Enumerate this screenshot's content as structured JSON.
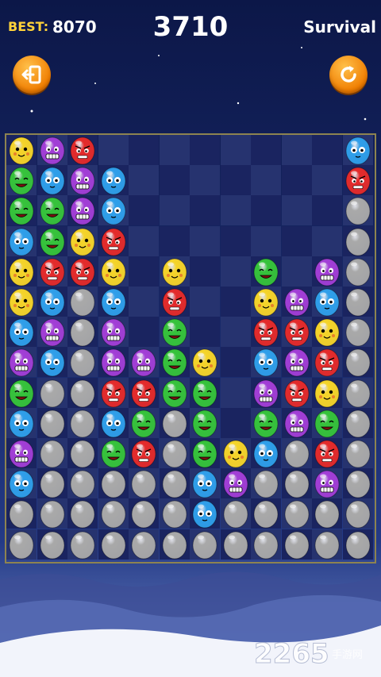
{
  "header": {
    "best_label": "BEST:",
    "best_value": "8070",
    "score": "3710",
    "mode": "Survival"
  },
  "buttons": {
    "exit_icon": "exit-door-icon",
    "restart_icon": "refresh-icon"
  },
  "colors": {
    "yellow": "#f5d42a",
    "purple": "#a23ed6",
    "red": "#e42b2b",
    "green": "#36c33b",
    "blue": "#2f9fea",
    "gray": "#a9a9a9",
    "button_orange": "#f59a14",
    "best_label": "#ffd23a"
  },
  "board": {
    "cols": 12,
    "rows": 14,
    "cells": [
      [
        "Y",
        "P",
        "R",
        "-",
        "-",
        "-",
        "-",
        "-",
        "-",
        "-",
        "-",
        "B"
      ],
      [
        "G",
        "B",
        "P",
        "B",
        "-",
        "-",
        "-",
        "-",
        "-",
        "-",
        "-",
        "R"
      ],
      [
        "G",
        "G",
        "P",
        "B",
        "-",
        "-",
        "-",
        "-",
        "-",
        "-",
        "-",
        "X"
      ],
      [
        "B",
        "G",
        "Y",
        "R",
        "-",
        "-",
        "-",
        "-",
        "-",
        "-",
        "-",
        "X"
      ],
      [
        "Y",
        "R",
        "R",
        "Y",
        "-",
        "Y",
        "-",
        "-",
        "G",
        "-",
        "P",
        "X"
      ],
      [
        "Y",
        "B",
        "X",
        "B",
        "-",
        "R",
        "-",
        "-",
        "Y",
        "P",
        "B",
        "X"
      ],
      [
        "B",
        "P",
        "X",
        "P",
        "-",
        "G",
        "-",
        "-",
        "R",
        "R",
        "Y",
        "X"
      ],
      [
        "P",
        "B",
        "X",
        "P",
        "P",
        "G",
        "Y",
        "-",
        "B",
        "P",
        "R",
        "X"
      ],
      [
        "G",
        "X",
        "X",
        "R",
        "R",
        "G",
        "G",
        "-",
        "P",
        "R",
        "Y",
        "X"
      ],
      [
        "B",
        "X",
        "X",
        "B",
        "G",
        "X",
        "G",
        "-",
        "G",
        "P",
        "G",
        "X"
      ],
      [
        "P",
        "X",
        "X",
        "G",
        "R",
        "X",
        "G",
        "Y",
        "B",
        "X",
        "R",
        "X"
      ],
      [
        "B",
        "X",
        "X",
        "X",
        "X",
        "X",
        "B",
        "P",
        "X",
        "X",
        "P",
        "X"
      ],
      [
        "X",
        "X",
        "X",
        "X",
        "X",
        "X",
        "B",
        "X",
        "X",
        "X",
        "X",
        "X"
      ],
      [
        "X",
        "X",
        "X",
        "X",
        "X",
        "X",
        "X",
        "X",
        "X",
        "X",
        "X",
        "X"
      ]
    ]
  },
  "watermark": {
    "number": "2265",
    "text": "手游网"
  }
}
